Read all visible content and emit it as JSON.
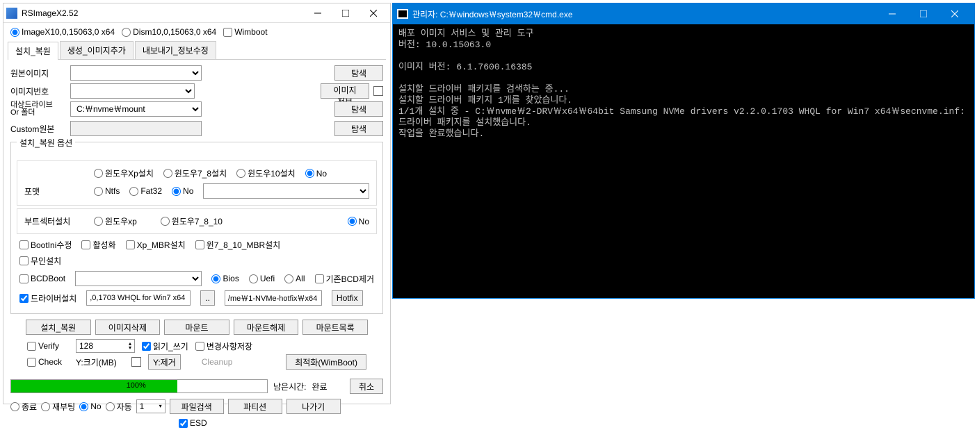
{
  "left": {
    "title": "RSImageX2.52",
    "modes": {
      "imagex": "ImageX10,0,15063,0 x64",
      "dism": "Dism10,0,15063,0 x64",
      "wimboot": "Wimboot"
    },
    "tabs": [
      "설치_복원",
      "생성_이미지추가",
      "내보내기_정보수정"
    ],
    "labels": {
      "src": "원본이미지",
      "idx": "이미지번호",
      "tgt": "대상드라이브\nOr 폴더",
      "custom": "Custom원본",
      "browse": "탐색",
      "imginfo": "이미지정보"
    },
    "values": {
      "tgt_path": "C:￦nvme￦mount"
    },
    "options": {
      "legend": "설치_복원 옵션",
      "os": {
        "xp": "윈도우Xp설치",
        "w78": "윈도우7_8설치",
        "w10": "윈도우10설치",
        "no": "No"
      },
      "fmt": {
        "label": "포맷",
        "ntfs": "Ntfs",
        "fat32": "Fat32",
        "no": "No"
      },
      "boot": {
        "label": "부트섹터설치",
        "xp": "윈도우xp",
        "w7810": "윈도우7_8_10",
        "no": "No"
      },
      "chks": {
        "bootini": "BootIni수정",
        "activate": "활성화",
        "xpmbr": "Xp_MBR설치",
        "w7mbr": "윈7_8_10_MBR설치",
        "unattend": "무인설치"
      },
      "bcd": {
        "label": "BCDBoot",
        "bios": "Bios",
        "uefi": "Uefi",
        "all": "All",
        "remove": "기존BCD제거"
      },
      "drv": {
        "label": "드라이버설치",
        "f1": ",0,1703 WHQL for Win7 x64",
        "dots": "..",
        "f2": "/me￦1-NVMe-hotfix￦x64",
        "hotfix": "Hotfix"
      }
    },
    "btns": {
      "install": "설치_복원",
      "imgdel": "이미지삭제",
      "mount": "마운트",
      "umount": "마운트해제",
      "mountlist": "마운트목록"
    },
    "flags": {
      "verify": "Verify",
      "size": "128",
      "rw": "읽기_쓰기",
      "savechg": "변경사항저장",
      "check": "Check",
      "ysize": "Y:크기(MB)",
      "yrm": "Y:제거",
      "cleanup": "Cleanup",
      "opt": "최적화(WimBoot)"
    },
    "progress": {
      "pct": "100%",
      "remain_lbl": "남은시간:",
      "remain_val": "완료",
      "cancel": "취소"
    },
    "end": {
      "shutdown": "종료",
      "reboot": "재부팅",
      "no": "No",
      "auto": "자동",
      "spin": "1",
      "filesearch": "파일검색",
      "partition": "파티션",
      "exit": "나가기",
      "esd": "ESD"
    }
  },
  "right": {
    "title": "관리자: C:￦windows￦system32￦cmd.exe",
    "lines": [
      "배포 이미지 서비스 및 관리 도구",
      "버전: 10.0.15063.0",
      "",
      "이미지 버전: 6.1.7600.16385",
      "",
      "설치할 드라이버 패키지를 검색하는 중...",
      "설치할 드라이버 패키지 1개를 찾았습니다.",
      "1/1개 설치 중 - C:￦nvme￦2-DRV￦x64￦64bit Samsung NVMe drivers v2.2.0.1703 WHQL for Win7 x64￦secnvme.inf: 드라이버 패키지를 설치했습니다.",
      "작업을 완료했습니다."
    ]
  }
}
